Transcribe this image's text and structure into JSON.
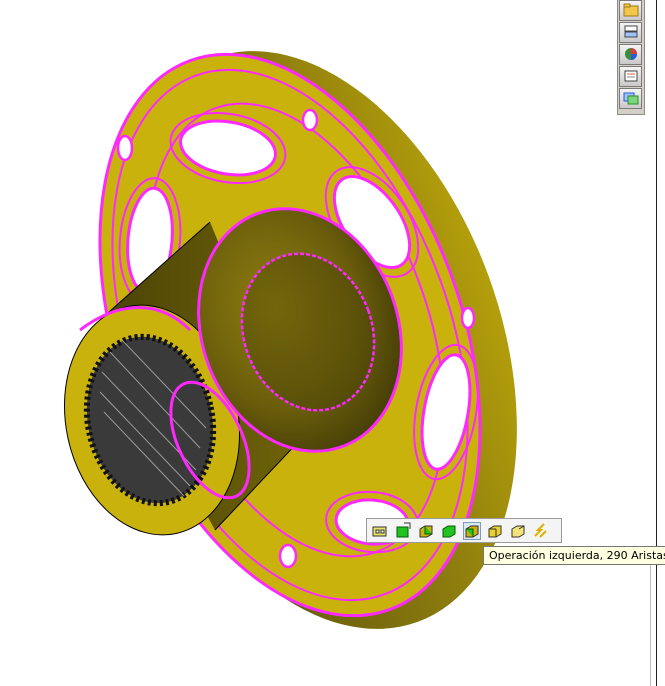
{
  "tooltip": {
    "text": "Operación izquierda, 290 Aristas"
  },
  "task_pane": {
    "buttons": [
      {
        "icon": "folder-icon"
      },
      {
        "icon": "design-library-icon"
      },
      {
        "icon": "appearance-globe-icon"
      },
      {
        "icon": "custom-properties-icon"
      },
      {
        "icon": "view-palette-icon"
      }
    ]
  },
  "mini_toolbar": {
    "buttons": [
      {
        "icon": "select-loop-icon"
      },
      {
        "icon": "select-face-green-icon"
      },
      {
        "icon": "select-feature-green-icon"
      },
      {
        "icon": "select-body-green-icon"
      },
      {
        "icon": "select-left-feature-icon",
        "selected": true
      },
      {
        "icon": "select-box-yellow-icon"
      },
      {
        "icon": "select-box-outline-icon"
      },
      {
        "icon": "select-tangency-icon"
      }
    ]
  },
  "colors": {
    "part_body": "#c9b20b",
    "part_shadow": "#5c520a",
    "edge_highlight": "#ff28ff",
    "spline": "#3a3a3a"
  }
}
